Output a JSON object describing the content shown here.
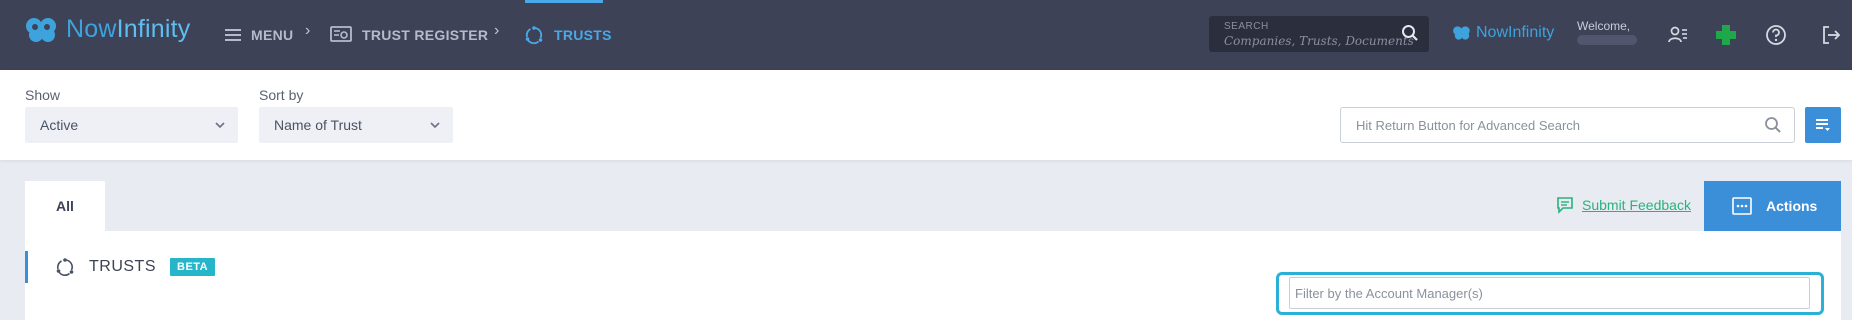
{
  "header": {
    "logo_text_1": "Now",
    "logo_text_2": "Infinity",
    "nav": {
      "menu_label": "MENU",
      "trust_register_label": "TRUST REGISTER",
      "trusts_label": "TRUSTS",
      "separator_1": "›",
      "separator_2": "›"
    },
    "search": {
      "label": "SEARCH",
      "placeholder": "Companies,  Trusts,  Documents"
    },
    "brand_small_1": "Now",
    "brand_small_2": "Infinity",
    "welcome": "Welcome,",
    "icons": [
      "user-list-icon",
      "plus-icon",
      "help-icon",
      "logout-icon"
    ]
  },
  "filters": {
    "show_label": "Show",
    "show_value": "Active",
    "sort_label": "Sort by",
    "sort_value": "Name of Trust",
    "advanced_search_placeholder": "Hit Return Button for Advanced Search"
  },
  "tabs": {
    "all_label": "All",
    "feedback_label": "Submit Feedback",
    "actions_label": "Actions"
  },
  "panel": {
    "title": "TRUSTS",
    "badge": "BETA",
    "account_manager_placeholder": "Filter by the Account Manager(s)"
  },
  "colors": {
    "topbar": "#3d4257",
    "accent": "#3b8fd9",
    "brand": "#3ea2dc",
    "feedback": "#2ab27b",
    "badge": "#26b5c9",
    "highlight": "#2bb0d8"
  }
}
